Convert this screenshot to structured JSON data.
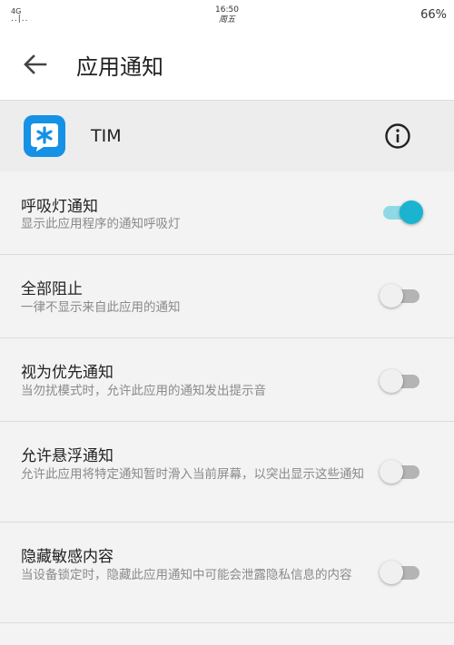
{
  "status_bar": {
    "network": "4G",
    "signal": "..|..",
    "time": "16:50",
    "day": "周五",
    "battery": "66%"
  },
  "header": {
    "title": "应用通知",
    "back_icon": "arrow-left-icon"
  },
  "app": {
    "name": "TIM",
    "icon": "tim-app-icon",
    "icon_color": "#1591e6",
    "info_icon": "info-circle-icon"
  },
  "colors": {
    "switch_on_thumb": "#1ab4d0",
    "switch_on_track": "#8fd9e6",
    "switch_off_track": "#b4b4b4"
  },
  "settings": [
    {
      "title": "呼吸灯通知",
      "summary": "显示此应用程序的通知呼吸灯",
      "enabled": true
    },
    {
      "title": "全部阻止",
      "summary": "一律不显示来自此应用的通知",
      "enabled": false
    },
    {
      "title": "视为优先通知",
      "summary": "当勿扰模式时，允许此应用的通知发出提示音",
      "enabled": false
    },
    {
      "title": "允许悬浮通知",
      "summary": "允许此应用将特定通知暂时滑入当前屏幕，以突出显示这些通知",
      "enabled": false
    },
    {
      "title": "隐藏敏感内容",
      "summary": "当设备锁定时，隐藏此应用通知中可能会泄露隐私信息的内容",
      "enabled": false
    }
  ]
}
